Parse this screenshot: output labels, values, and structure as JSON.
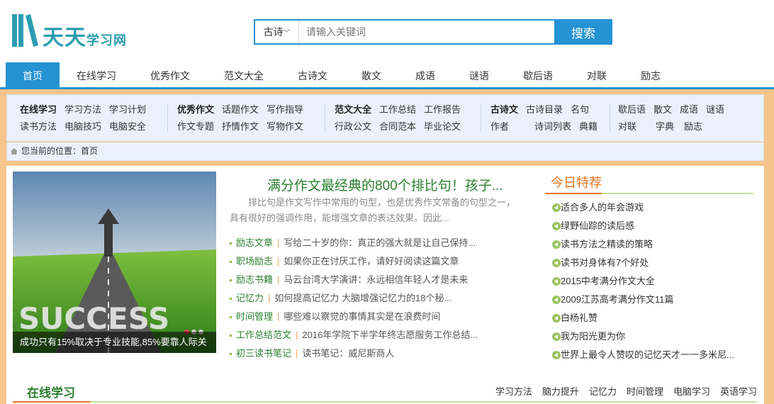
{
  "header": {
    "logo_text": "天天",
    "logo_sub": "学习网",
    "search": {
      "select_value": "古诗",
      "placeholder": "请输入关键词",
      "button_label": "搜索"
    }
  },
  "nav": {
    "items": [
      "首页",
      "在线学习",
      "优秀作文",
      "范文大全",
      "古诗文",
      "散文",
      "成语",
      "谜语",
      "歇后语",
      "对联",
      "励志"
    ]
  },
  "subnav": {
    "groups": [
      {
        "row1": [
          "在线学习",
          "学习方法",
          "学习计划"
        ],
        "row2": [
          "读书方法",
          "电脑技巧",
          "电脑安全"
        ]
      },
      {
        "row1": [
          "优秀作文",
          "话题作文",
          "写作指导"
        ],
        "row2": [
          "作文专题",
          "抒情作文",
          "写物作文"
        ]
      },
      {
        "row1": [
          "范文大全",
          "工作总结",
          "工作报告"
        ],
        "row2": [
          "行政公文",
          "合同范本",
          "毕业论文"
        ]
      },
      {
        "row1": [
          "古诗文",
          "古诗目录",
          "名句"
        ],
        "row2": [
          "作者",
          "诗词列表",
          "典籍"
        ]
      },
      {
        "row1": [
          "歇后语",
          "散文",
          "成语",
          "谜语"
        ],
        "row2": [
          "对联",
          "字典",
          "励志"
        ]
      }
    ],
    "breadcrumb_prefix": "您当前的位置：",
    "breadcrumb_home": "首页"
  },
  "hero": {
    "caption": "成功只有15%取决于专业技能,85%要靠人际关",
    "image_word": "SUCCESS"
  },
  "feature": {
    "headline": "满分作文最经典的800个排比句！孩子...",
    "summary": "排比句是作文写作中常用的句型，也是优秀作文常备的句型之一，具有很好的强调作用，能增强文章的表达效果。因此..."
  },
  "news": [
    {
      "cat": "励志文章",
      "title": "写给二十岁的你：真正的强大就是让自己保持..."
    },
    {
      "cat": "职场励志",
      "title": "如果你正在讨厌工作，请好好阅读这篇文章"
    },
    {
      "cat": "励志书籍",
      "title": "马云台湾大学演讲：永远相信年轻人才是未来"
    },
    {
      "cat": "记忆力",
      "title": "如何提高记忆力 大脑增强记忆力的18个秘..."
    },
    {
      "cat": "时间管理",
      "title": "哪些难以察觉的事情其实是在浪费时间"
    },
    {
      "cat": "工作总结范文",
      "title": "2016年学院下半学年终志愿服务工作总结..."
    },
    {
      "cat": "初三读书笔记",
      "title": "读书笔记：威尼斯商人"
    }
  ],
  "today": {
    "title": "今日特荐",
    "items": [
      "适合多人的年会游戏",
      "绿野仙踪的读后感",
      "读书方法之精读的策略",
      "读书对身体有7个好处",
      "2015中考满分作文大全",
      "2009江苏高考满分作文11篇",
      "白杨礼赞",
      "我为阳光更为你",
      "世界上最令人赞叹的记忆天才一一多米尼..."
    ]
  },
  "section2": {
    "title": "在线学习",
    "links": [
      "学习方法",
      "脑力提升",
      "记忆力",
      "时间管理",
      "电脑学习",
      "英语学习"
    ]
  },
  "colors": {
    "brand_blue": "#2592d3",
    "logo_teal": "#2a9db0",
    "green": "#2b7f2f",
    "orange": "#e8741f",
    "frame": "#f5c58c"
  }
}
